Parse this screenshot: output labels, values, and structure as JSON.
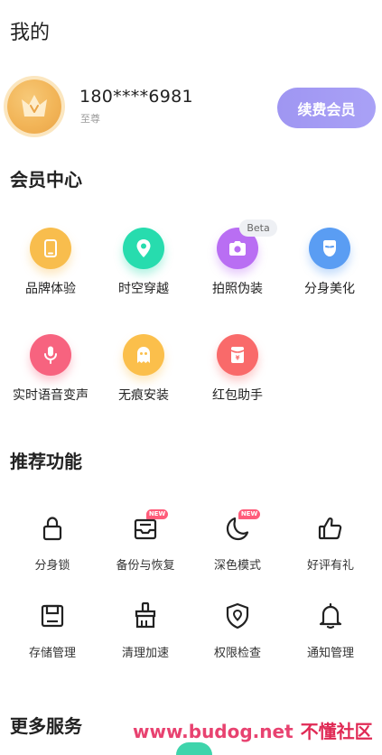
{
  "page": {
    "title": "我的"
  },
  "profile": {
    "phone": "180****6981",
    "level": "至尊",
    "renew_label": "续费会员"
  },
  "member_center": {
    "title": "会员中心",
    "beta_badge": "Beta",
    "items": [
      {
        "label": "品牌体验",
        "icon": "phone-icon",
        "color": "#f8bd4d"
      },
      {
        "label": "时空穿越",
        "icon": "location-pin-icon",
        "color": "#27dcae"
      },
      {
        "label": "拍照伪装",
        "icon": "camera-icon",
        "color": "#b96ef3"
      },
      {
        "label": "分身美化",
        "icon": "mask-icon",
        "color": "#5a9df3"
      },
      {
        "label": "实时语音变声",
        "icon": "microphone-icon",
        "color": "#f7637f"
      },
      {
        "label": "无痕安装",
        "icon": "ghost-icon",
        "color": "#fbbf4b"
      },
      {
        "label": "红包助手",
        "icon": "red-envelope-icon",
        "color": "#f96a6a"
      }
    ]
  },
  "recommended": {
    "title": "推荐功能",
    "new_badge": "NEW",
    "items": [
      {
        "label": "分身锁",
        "icon": "lock-icon"
      },
      {
        "label": "备份与恢复",
        "icon": "backup-box-icon"
      },
      {
        "label": "深色模式",
        "icon": "moon-icon"
      },
      {
        "label": "好评有礼",
        "icon": "thumbs-up-icon"
      },
      {
        "label": "存储管理",
        "icon": "storage-icon"
      },
      {
        "label": "清理加速",
        "icon": "brush-icon"
      },
      {
        "label": "权限检查",
        "icon": "shield-icon"
      },
      {
        "label": "通知管理",
        "icon": "bell-icon"
      }
    ]
  },
  "more_services": {
    "title": "更多服务"
  },
  "watermark": {
    "url": "www.budog.net",
    "name": "不懂社区"
  }
}
